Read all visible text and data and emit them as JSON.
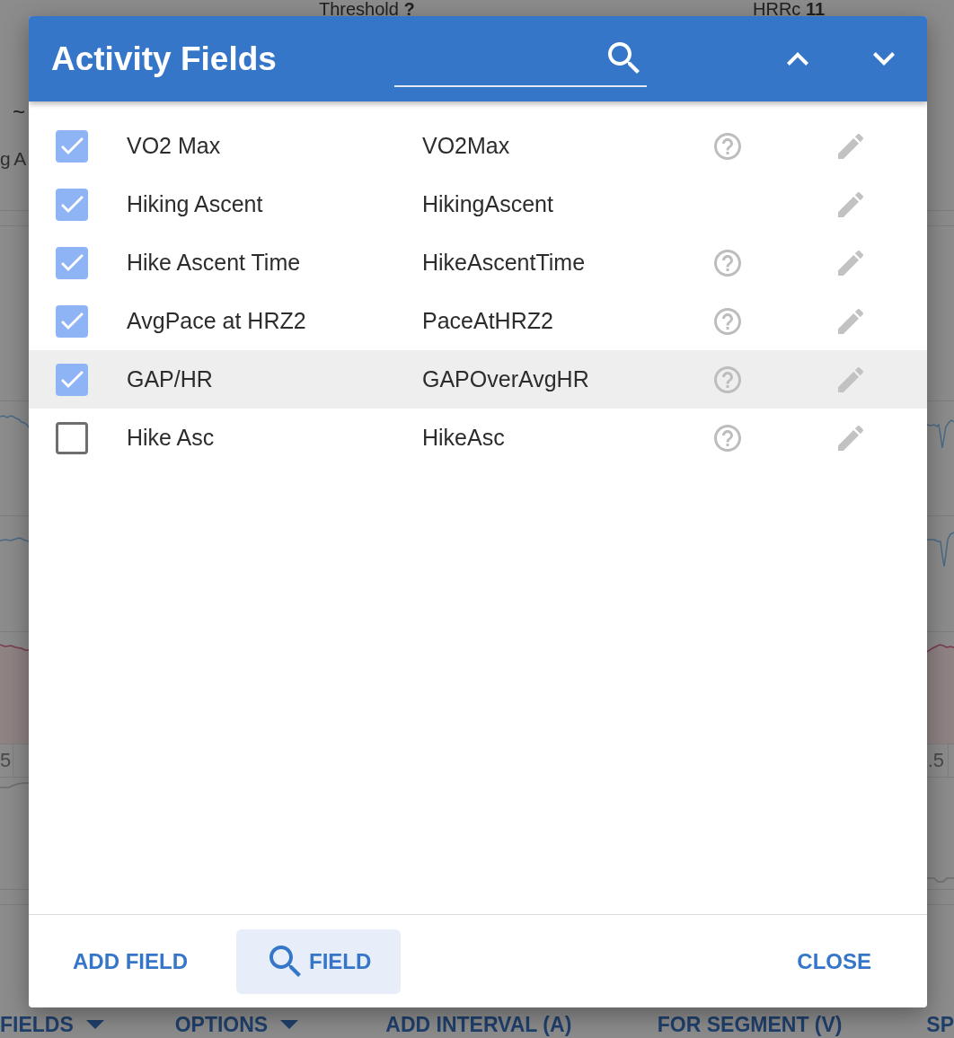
{
  "background": {
    "stats": [
      "Threshold **?**",
      "HRRc **11**"
    ],
    "side_texts": [
      "~",
      "g A"
    ],
    "tick_labels": [
      "5",
      ".5"
    ],
    "toolbar": [
      {
        "label": "FIELDS",
        "dropdown": true
      },
      {
        "label": "OPTIONS",
        "dropdown": true
      },
      {
        "label": "ADD INTERVAL (A)",
        "dropdown": false
      },
      {
        "label": "FOR SEGMENT (V)",
        "dropdown": false
      },
      {
        "label": "SP",
        "dropdown": false
      }
    ]
  },
  "dialog": {
    "title": "Activity Fields",
    "fields": [
      {
        "name": "VO2 Max",
        "code": "VO2Max",
        "checked": true,
        "help": true,
        "highlighted": false
      },
      {
        "name": "Hiking Ascent",
        "code": "HikingAscent",
        "checked": true,
        "help": false,
        "highlighted": false
      },
      {
        "name": "Hike Ascent Time",
        "code": "HikeAscentTime",
        "checked": true,
        "help": true,
        "highlighted": false
      },
      {
        "name": "AvgPace at HRZ2",
        "code": "PaceAtHRZ2",
        "checked": true,
        "help": true,
        "highlighted": false
      },
      {
        "name": "GAP/HR",
        "code": "GAPOverAvgHR",
        "checked": true,
        "help": true,
        "highlighted": true
      },
      {
        "name": "Hike Asc",
        "code": "HikeAsc",
        "checked": false,
        "help": true,
        "highlighted": false
      }
    ],
    "buttons": [
      {
        "label": "ADD FIELD",
        "kind": "text"
      },
      {
        "label": "FIELD",
        "kind": "search"
      },
      {
        "label": "CLOSE",
        "kind": "text"
      }
    ]
  }
}
